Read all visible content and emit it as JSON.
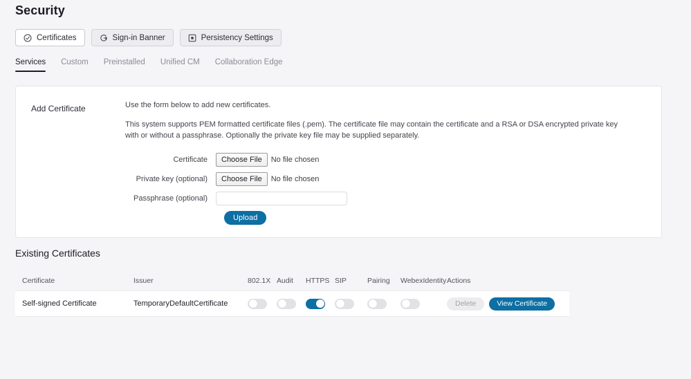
{
  "header": {
    "title": "Security"
  },
  "segmented_buttons": [
    {
      "label": "Certificates",
      "icon": "check-circle-icon",
      "active": true
    },
    {
      "label": "Sign-in Banner",
      "icon": "sign-in-icon",
      "active": false
    },
    {
      "label": "Persistency Settings",
      "icon": "square-dot-icon",
      "active": false
    }
  ],
  "tabs": [
    {
      "label": "Services",
      "active": true
    },
    {
      "label": "Custom",
      "active": false
    },
    {
      "label": "Preinstalled",
      "active": false
    },
    {
      "label": "Unified CM",
      "active": false
    },
    {
      "label": "Collaboration Edge",
      "active": false
    }
  ],
  "add_certificate": {
    "section_label": "Add Certificate",
    "intro": "Use the form below to add new certificates.",
    "description": "This system supports PEM formatted certificate files (.pem). The certificate file may contain the certificate and a RSA or DSA encrypted private key with or without a passphrase. Optionally the private key file may be supplied separately.",
    "fields": [
      {
        "label": "Certificate",
        "type": "file",
        "button_label": "Choose File",
        "status": "No file chosen"
      },
      {
        "label": "Private key (optional)",
        "type": "file",
        "button_label": "Choose File",
        "status": "No file chosen"
      },
      {
        "label": "Passphrase (optional)",
        "type": "text",
        "value": "",
        "placeholder": ""
      }
    ],
    "submit_label": "Upload"
  },
  "existing_certificates": {
    "title": "Existing Certificates",
    "columns": [
      "Certificate",
      "Issuer",
      "802.1X",
      "Audit",
      "HTTPS",
      "SIP",
      "Pairing",
      "WebexIdentity",
      "Actions"
    ],
    "rows": [
      {
        "certificate": "Self-signed Certificate",
        "issuer": "TemporaryDefaultCertificate",
        "toggles": {
          "dot1x": false,
          "audit": false,
          "https": true,
          "sip": false,
          "pairing": false,
          "webexidentity": false
        },
        "delete_label": "Delete",
        "delete_disabled": true,
        "view_label": "View Certificate"
      }
    ]
  },
  "colors": {
    "accent_blue": "#0d6fa3",
    "page_background": "#f5f4f7",
    "card_background": "#ffffff",
    "toggle_off": "#e2e2e6",
    "text_primary": "#22242a",
    "text_muted": "#8c8d94"
  }
}
